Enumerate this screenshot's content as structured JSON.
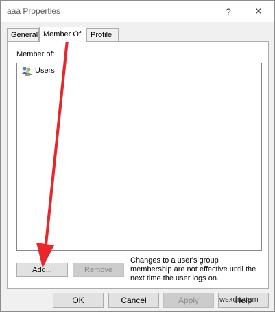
{
  "window": {
    "title": "aaa Properties",
    "help_glyph": "?",
    "close_glyph": "✕"
  },
  "tabs": [
    {
      "label": "General"
    },
    {
      "label": "Member Of",
      "active": true
    },
    {
      "label": "Profile"
    }
  ],
  "member_of": {
    "label": "Member of:",
    "items": [
      {
        "label": "Users",
        "icon": "users-group-icon"
      }
    ]
  },
  "panel_buttons": {
    "add": "Add...",
    "remove": "Remove"
  },
  "info_text": "Changes to a user's group membership are not effective until the next time the user logs on.",
  "footer_buttons": {
    "ok": "OK",
    "cancel": "Cancel",
    "apply": "Apply",
    "help": "Help"
  },
  "watermark": "wsxdn.com",
  "colors": {
    "arrow": "#e8262b"
  }
}
